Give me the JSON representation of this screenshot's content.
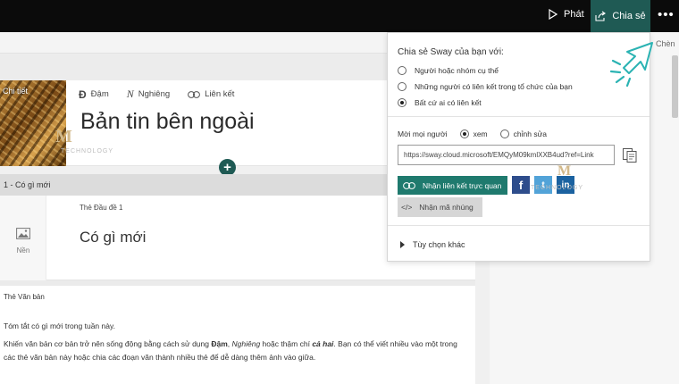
{
  "topbar": {
    "play_label": "Phát",
    "share_label": "Chia sẻ",
    "more_label": "•••",
    "share_bg": "#1f5a54"
  },
  "right_panel": {
    "chen_label": "Chèn"
  },
  "title_card": {
    "details_label": "Chi tiết",
    "format": {
      "bold": "Đậm",
      "italic": "Nghiêng",
      "link": "Liên kết"
    },
    "bold_glyph": "Đ",
    "italic_glyph": "N",
    "title": "Bản tin bên ngoài",
    "add_button": "+"
  },
  "section": {
    "label": "1 - Có gì mới",
    "background_label": "Nền",
    "heading_card_label": "Thẻ Đầu đề 1",
    "heading_text": "Có gì mới"
  },
  "text_card": {
    "label": "Thẻ Văn bản",
    "p1": "Tóm tắt có gì mới trong tuần này.",
    "p2_a": "Khiến văn bản cơ bản trở nên sống động bằng cách sử dụng ",
    "p2_bold": "Đậm",
    "p2_b": ", ",
    "p2_italic": "Nghiêng",
    "p2_c": " hoặc thậm chí ",
    "p2_bold_italic": "cả hai",
    "p2_d": ". Bạn có thể viết nhiều vào một trong các thẻ văn bản này hoặc chia các đoạn văn thành nhiều thẻ để dễ dàng thêm ảnh vào giữa."
  },
  "share_dialog": {
    "title": "Chia sẻ Sway của bạn với:",
    "options": [
      {
        "label": "Người hoặc nhóm cụ thể",
        "selected": false
      },
      {
        "label": "Những người có liên kết trong tổ chức của bạn",
        "selected": false
      },
      {
        "label": "Bất cứ ai có liên kết",
        "selected": true
      }
    ],
    "invite_label": "Mời mọi người",
    "permissions": [
      {
        "label": "xem",
        "selected": true
      },
      {
        "label": "chỉnh sửa",
        "selected": false
      }
    ],
    "url": "https://sway.cloud.microsoft/EMQyM09kmlXXB4ud?ref=Link",
    "visual_link_button": "Nhận liên kết trực quan",
    "social": {
      "facebook": "f",
      "twitter": "t",
      "linkedin": "in"
    },
    "embed_button": "Nhận mã nhúng",
    "embed_glyph": "</>",
    "more_options": "Tùy chọn khác",
    "accent": "#1f7a6e"
  },
  "watermark": {
    "letter": "M",
    "text": "TECHNOLOGY"
  }
}
